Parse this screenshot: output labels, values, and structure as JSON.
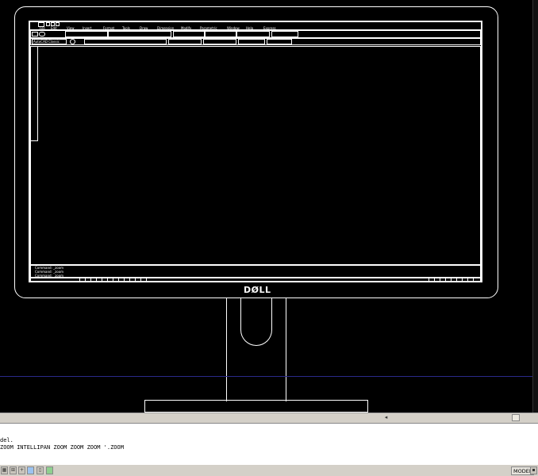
{
  "drawing": {
    "monitor_brand": "DØLL",
    "menu_items": [
      "File",
      "Edit",
      "View",
      "Insert",
      "Format",
      "Tools",
      "Draw",
      "Dimension",
      "Modify",
      "Parametric",
      "Window",
      "Help",
      "Express"
    ],
    "layer_field": "AutoCAD Classic",
    "inner_commands": [
      "Command: _zoom",
      "Command: _zoom",
      "Command: _zoom"
    ]
  },
  "command_window": {
    "lines": [
      "del.",
      "ZOOM INTELLIPAN ZOOM ZOOM ZOOM '.ZOOM"
    ]
  },
  "status_bar": {
    "model_label": "MODEL"
  },
  "colors": {
    "canvas": "#000000",
    "lines": "#ffffff",
    "ucs_line": "#2a2a8a",
    "chrome": "#d4d0c8"
  }
}
